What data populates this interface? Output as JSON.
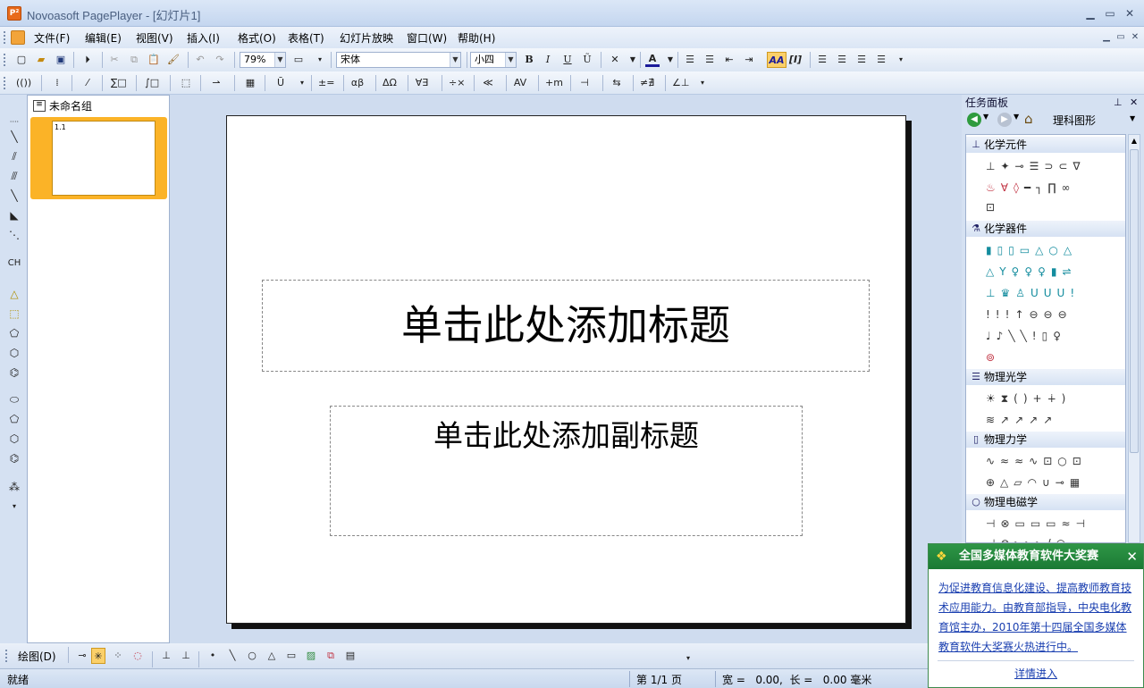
{
  "window": {
    "title": "Novoasoft PagePlayer - [幻灯片1]",
    "app_icon_text": "P²"
  },
  "menubar": {
    "items": [
      "文件(F)",
      "编辑(E)",
      "视图(V)",
      "插入(I)",
      "格式(O)",
      "表格(T)",
      "幻灯片放映",
      "窗口(W)",
      "帮助(H)"
    ]
  },
  "toolbar": {
    "zoom": "79%",
    "font_name": "宋体",
    "font_size": "小四",
    "bold": "B",
    "italic": "I",
    "underline": "U",
    "special_u": "Ũ",
    "font_color": "A",
    "aa": "AA",
    "italic_bracket": "[I]"
  },
  "toolbar2": {
    "items": [
      "(())",
      "⁞",
      "∑□",
      "∫□",
      "±=",
      "αβ",
      "ΔΩ",
      "∀∃",
      "÷×",
      "≪",
      "AV",
      "+m",
      "⇆",
      "≠∄",
      "∠⊥"
    ]
  },
  "left_tools": {
    "ch_label": "CH"
  },
  "slide_panel": {
    "group_title": "未命名组",
    "thumb_label": "1.1"
  },
  "slide": {
    "title_placeholder": "单击此处添加标题",
    "subtitle_placeholder": "单击此处添加副标题"
  },
  "task_pane": {
    "title": "任务面板",
    "dropdown": "理科图形",
    "categories": [
      {
        "name": "化学元件",
        "icon": "stand-icon"
      },
      {
        "name": "化学器件",
        "icon": "flask-icon"
      },
      {
        "name": "物理光学",
        "icon": "optics-icon"
      },
      {
        "name": "物理力学",
        "icon": "battery-icon"
      },
      {
        "name": "物理电磁学",
        "icon": "bulb-icon"
      }
    ]
  },
  "popup": {
    "title": "全国多媒体教育软件大奖赛",
    "close": "✕",
    "body": "为促进教育信息化建设、提高教师教育技术应用能力。由教育部指导，中央电化教育馆主办，2010年第十四届全国多媒体教育软件大奖赛火热进行中。",
    "link": "详情进入"
  },
  "drawbar": {
    "label": "绘图(D)"
  },
  "statusbar": {
    "status": "就绪",
    "page": "第 1/1 页",
    "dims": "宽 =   0.00,  长 =   0.00 毫米"
  }
}
